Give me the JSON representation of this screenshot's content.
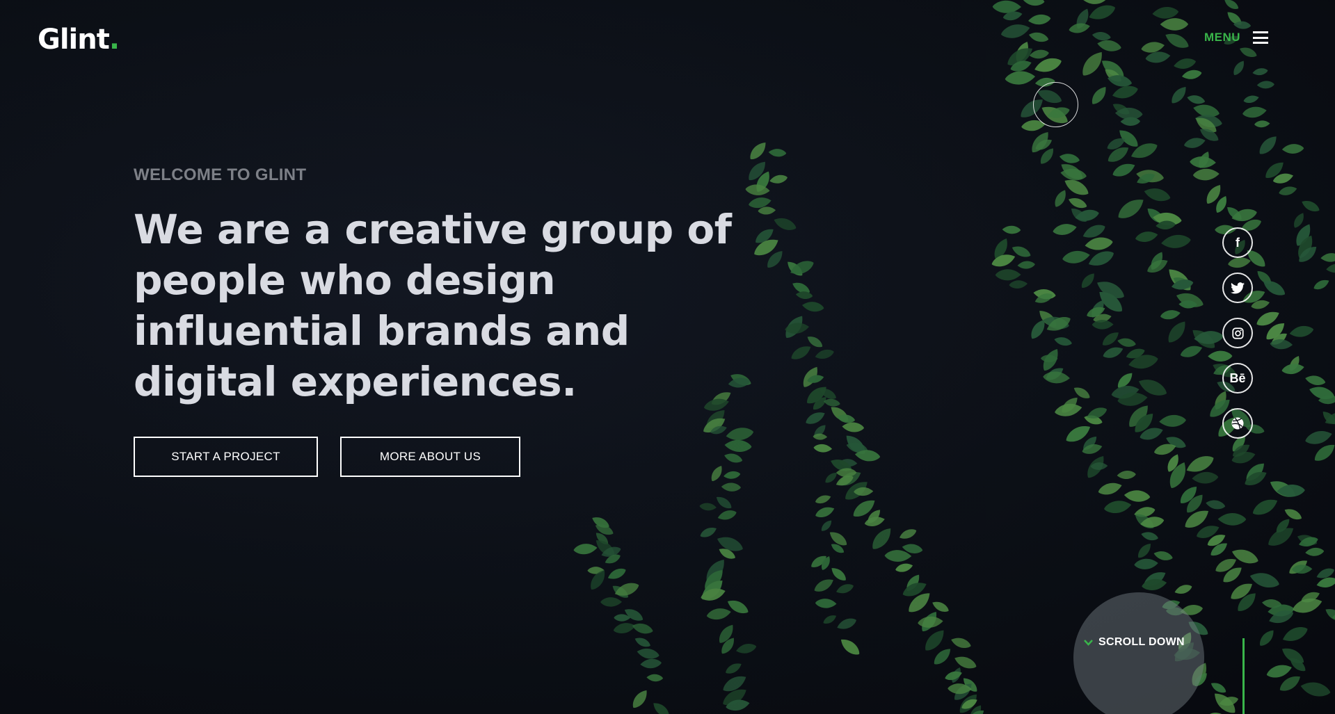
{
  "header": {
    "logo_text": "Glint",
    "logo_dot": ".",
    "menu_label": "MENU"
  },
  "hero": {
    "eyebrow": "WELCOME TO GLINT",
    "headline": "We are a creative group of people who design influential brands and digital experiences.",
    "buttons": [
      {
        "label": "START A PROJECT"
      },
      {
        "label": "MORE ABOUT US"
      }
    ]
  },
  "social": [
    {
      "name": "facebook",
      "icon": "facebook-icon",
      "glyph": "f"
    },
    {
      "name": "twitter",
      "icon": "twitter-icon",
      "glyph": ""
    },
    {
      "name": "instagram",
      "icon": "instagram-icon",
      "glyph": ""
    },
    {
      "name": "behance",
      "icon": "behance-icon",
      "glyph": "Bē"
    },
    {
      "name": "dribbble",
      "icon": "dribbble-icon",
      "glyph": ""
    }
  ],
  "scroll": {
    "label": "SCROLL DOWN"
  },
  "colors": {
    "accent": "#39b54a",
    "background": "#0b0e15",
    "headline": "#d9dbe2",
    "eyebrow": "#7d8087",
    "leaf_dark": "#1f4a2c",
    "leaf_mid": "#2f6b3a",
    "leaf_light": "#4d8a44"
  }
}
